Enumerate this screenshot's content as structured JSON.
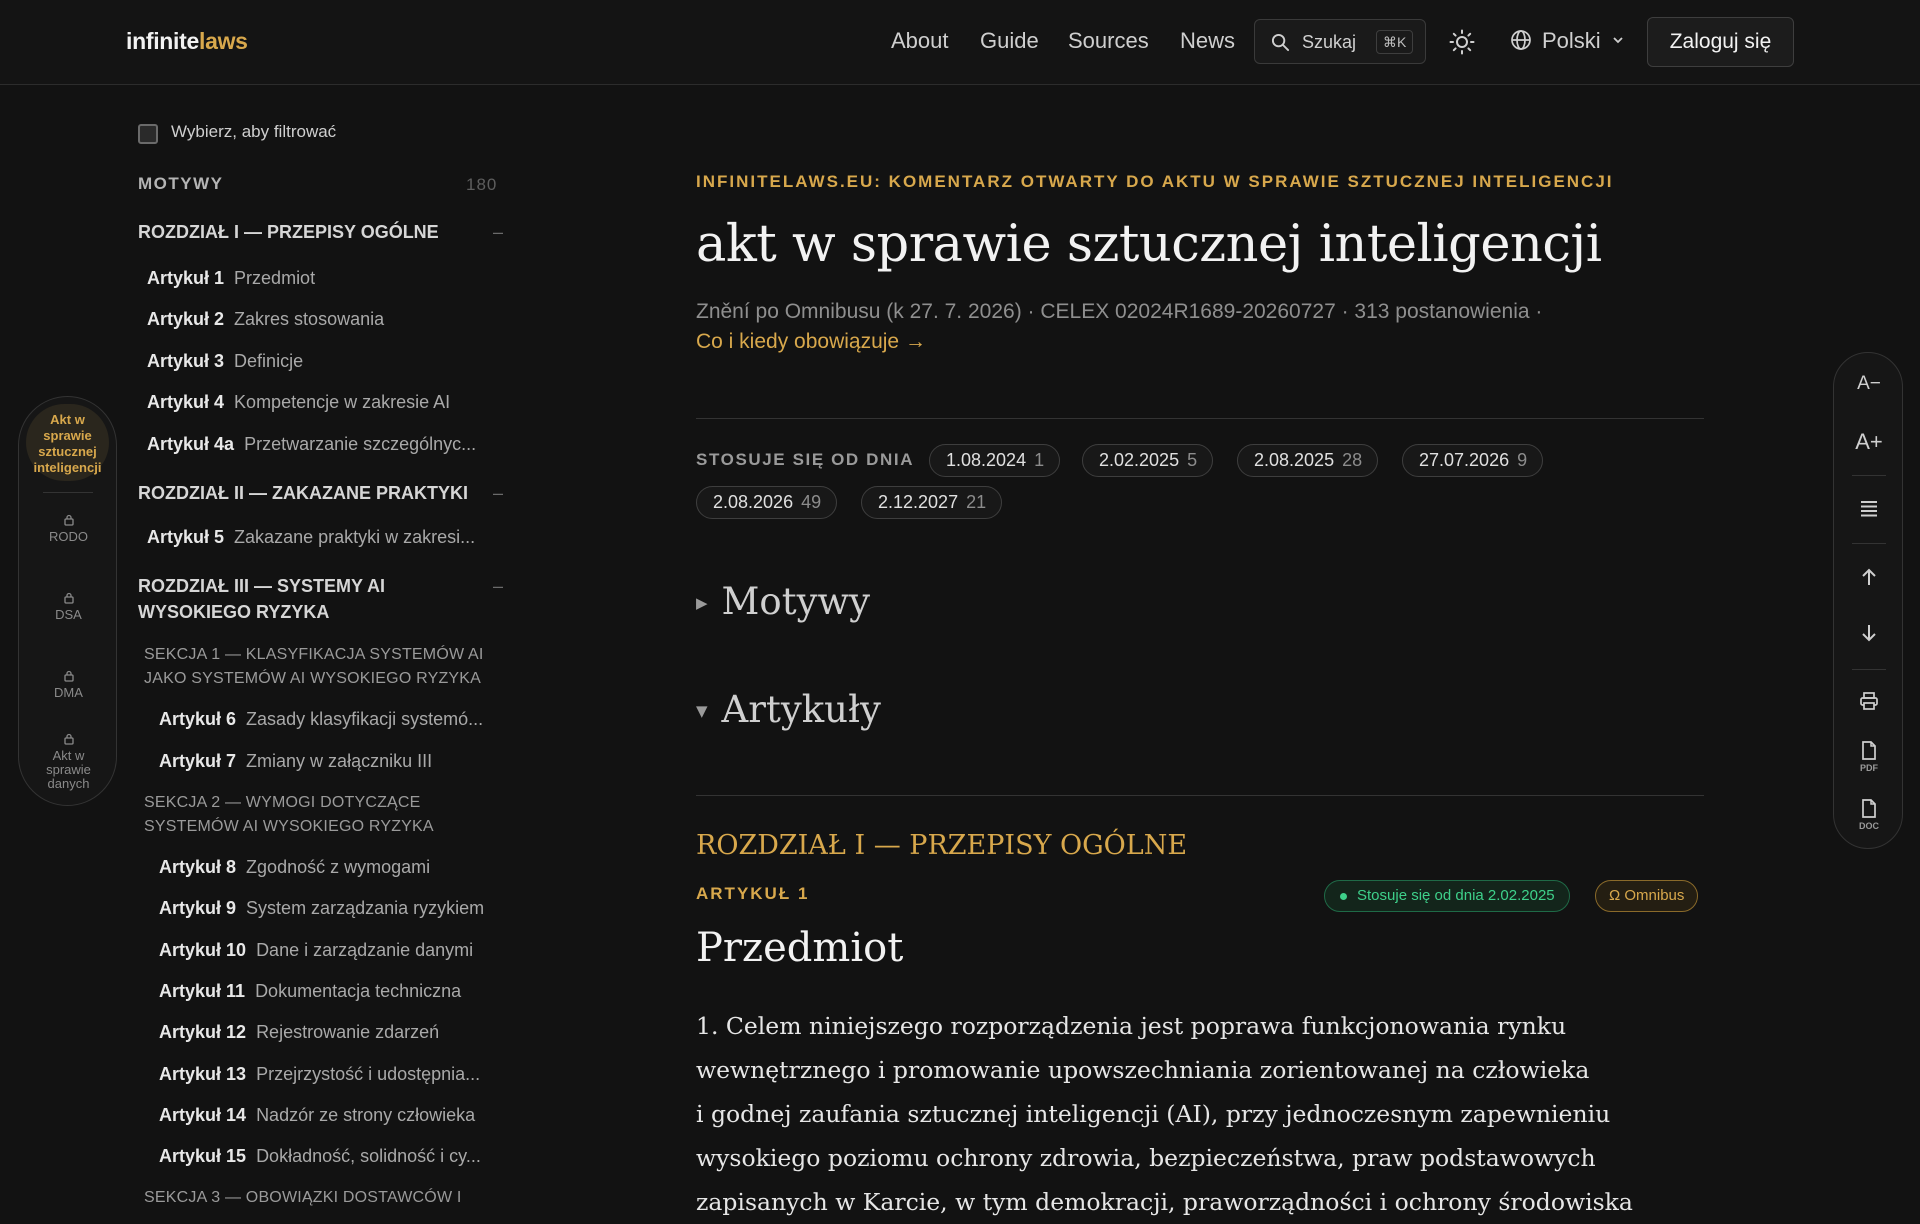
{
  "header": {
    "logo_part1": "infinite",
    "logo_part2": "laws",
    "nav": [
      "About",
      "Guide",
      "Sources",
      "News"
    ],
    "search_label": "Szukaj",
    "search_shortcut": "⌘K",
    "language": "Polski",
    "login_label": "Zaloguj się"
  },
  "rail": {
    "active": "Akt w sprawie sztucznej inteligencji",
    "items": [
      "RODO",
      "DSA",
      "DMA",
      "Akt w sprawie danych"
    ]
  },
  "sidebar": {
    "filter_label": "Wybierz, aby filtrować",
    "recitals_label": "MOTYWY",
    "recitals_count": "180",
    "chapter1": "ROZDZIAŁ I — PRZEPISY OGÓLNE",
    "chapter2": "ROZDZIAŁ II — ZAKAZANE PRAKTYKI",
    "chapter3": "ROZDZIAŁ III — SYSTEMY AI WYSOKIEGO RYZYKA",
    "section1": "SEKCJA 1 — KLASYFIKACJA SYSTEMÓW AI JAKO SYSTEMÓW AI WYSOKIEGO RYZYKA",
    "section2": "SEKCJA 2 — WYMOGI DOTYCZĄCE SYSTEMÓW AI WYSOKIEGO RYZYKA",
    "section3": "SEKCJA 3 — OBOWIĄZKI DOSTAWCÓW I",
    "articles": [
      {
        "num": "Artykuł 1",
        "title": "Przedmiot"
      },
      {
        "num": "Artykuł 2",
        "title": "Zakres stosowania"
      },
      {
        "num": "Artykuł 3",
        "title": "Definicje"
      },
      {
        "num": "Artykuł 4",
        "title": "Kompetencje w zakresie AI"
      },
      {
        "num": "Artykuł 4a",
        "title": "Przetwarzanie szczególnyc..."
      },
      {
        "num": "Artykuł 5",
        "title": "Zakazane praktyki w zakresi..."
      },
      {
        "num": "Artykuł 6",
        "title": "Zasady klasyfikacji systemó..."
      },
      {
        "num": "Artykuł 7",
        "title": "Zmiany w załączniku III"
      },
      {
        "num": "Artykuł 8",
        "title": "Zgodność z wymogami"
      },
      {
        "num": "Artykuł 9",
        "title": "System zarządzania ryzykiem"
      },
      {
        "num": "Artykuł 10",
        "title": "Dane i zarządzanie danymi"
      },
      {
        "num": "Artykuł 11",
        "title": "Dokumentacja techniczna"
      },
      {
        "num": "Artykuł 12",
        "title": "Rejestrowanie zdarzeń"
      },
      {
        "num": "Artykuł 13",
        "title": "Przejrzystość i udostępnia..."
      },
      {
        "num": "Artykuł 14",
        "title": "Nadzór ze strony człowieka"
      },
      {
        "num": "Artykuł 15",
        "title": "Dokładność, solidność i cy..."
      }
    ]
  },
  "main": {
    "kicker": "INFINITELAWS.EU: KOMENTARZ OTWARTY DO AKTU W SPRAWIE SZTUCZNEJ INTELIGENCJI",
    "title": "akt w sprawie sztucznej inteligencji",
    "meta": "Znění po Omnibusu (k 27. 7. 2026) · CELEX 02024R1689-20260727 · 313 postanowienia ·",
    "meta_link": "Co i kiedy obowiązuje →",
    "applies_label": "STOSUJE SIĘ OD DNIA",
    "dates": [
      {
        "date": "1.08.2024",
        "count": "1"
      },
      {
        "date": "2.02.2025",
        "count": "5"
      },
      {
        "date": "2.08.2025",
        "count": "28"
      },
      {
        "date": "27.07.2026",
        "count": "9"
      },
      {
        "date": "2.08.2026",
        "count": "49"
      },
      {
        "date": "2.12.2027",
        "count": "21"
      }
    ],
    "recitals_toggle": "Motywy",
    "articles_toggle": "Artykuły",
    "chapter_heading": "ROZDZIAŁ I — PRZEPISY OGÓLNE",
    "article_kicker": "ARTYKUŁ 1",
    "badge_applies": "Stosuje się od dnia 2.02.2025",
    "badge_omnibus": "Ω Omnibus",
    "article_title": "Przedmiot",
    "body_lines": [
      "1.  Celem niniejszego rozporządzenia jest poprawa funkcjonowania rynku",
      "wewnętrznego i promowanie upowszechniania zorientowanej na człowieka",
      "i godnej zaufania sztucznej inteligencji (AI), przy jednoczesnym zapewnieniu",
      "wysokiego poziomu ochrony zdrowia, bezpieczeństwa, praw podstawowych",
      "zapisanych w Karcie, w tym demokracji, praworządności i ochrony środowiska"
    ]
  },
  "toolbar": {
    "font_decrease": "A−",
    "font_increase": "A+",
    "pdf_label": "PDF",
    "doc_label": "DOC"
  },
  "colors": {
    "accent": "#d8a84c",
    "background": "#121212",
    "status_green": "#3ed08a"
  }
}
